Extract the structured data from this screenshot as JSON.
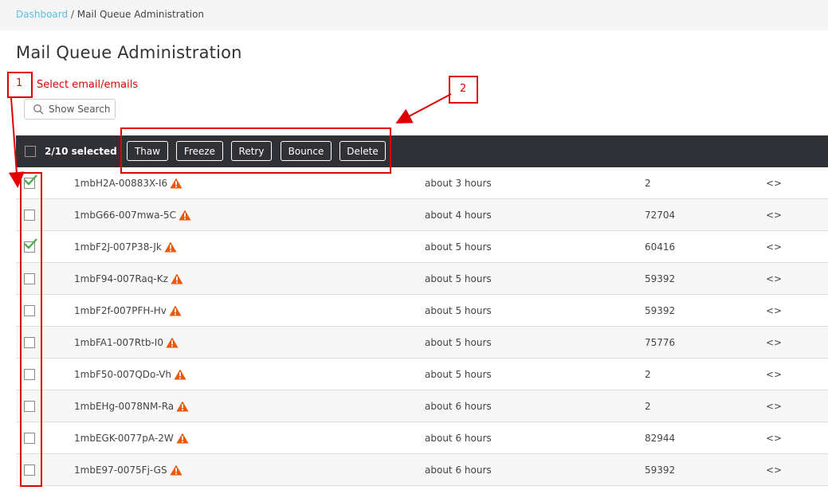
{
  "breadcrumb": {
    "home": "Dashboard",
    "separator": " / ",
    "current": "Mail Queue Administration"
  },
  "page_title": "Mail Queue Administration",
  "search_button": {
    "label": "Show Search",
    "icon": "search-icon"
  },
  "toolbar": {
    "selected_count": "2/10 selected",
    "buttons": {
      "thaw": "Thaw",
      "freeze": "Freeze",
      "retry": "Retry",
      "bounce": "Bounce",
      "delete": "Delete"
    }
  },
  "rows": [
    {
      "id": "1mbH2A-00883X-I6",
      "age": "about 3 hours",
      "size": "2",
      "ctl": "<>",
      "checked": true
    },
    {
      "id": "1mbG66-007mwa-5C",
      "age": "about 4 hours",
      "size": "72704",
      "ctl": "<>",
      "checked": false
    },
    {
      "id": "1mbF2J-007P38-Jk",
      "age": "about 5 hours",
      "size": "60416",
      "ctl": "<>",
      "checked": true
    },
    {
      "id": "1mbF94-007Raq-Kz",
      "age": "about 5 hours",
      "size": "59392",
      "ctl": "<>",
      "checked": false
    },
    {
      "id": "1mbF2f-007PFH-Hv",
      "age": "about 5 hours",
      "size": "59392",
      "ctl": "<>",
      "checked": false
    },
    {
      "id": "1mbFA1-007Rtb-I0",
      "age": "about 5 hours",
      "size": "75776",
      "ctl": "<>",
      "checked": false
    },
    {
      "id": "1mbF50-007QDo-Vh",
      "age": "about 5 hours",
      "size": "2",
      "ctl": "<>",
      "checked": false
    },
    {
      "id": "1mbEHg-0078NM-Ra",
      "age": "about 6 hours",
      "size": "2",
      "ctl": "<>",
      "checked": false
    },
    {
      "id": "1mbEGK-0077pA-2W",
      "age": "about 6 hours",
      "size": "82944",
      "ctl": "<>",
      "checked": false
    },
    {
      "id": "1mbE97-0075Fj-GS",
      "age": "about 6 hours",
      "size": "59392",
      "ctl": "<>",
      "checked": false
    }
  ],
  "annotations": {
    "one": {
      "number": "1",
      "text": "Select email/emails"
    },
    "two": {
      "number": "2"
    }
  },
  "colors": {
    "annotation": "#e00000",
    "toolbar": "#2f3136",
    "link": "#5bc0de",
    "warning": "#e8590c",
    "check": "#4cae4c"
  }
}
